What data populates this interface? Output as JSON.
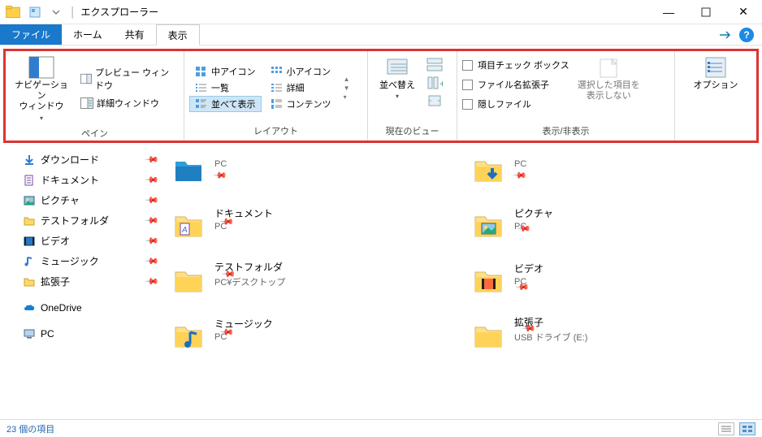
{
  "title": "エクスプローラー",
  "tabs": {
    "file": "ファイル",
    "home": "ホーム",
    "share": "共有",
    "view": "表示"
  },
  "ribbon": {
    "panes": {
      "label": "ペイン",
      "nav": "ナビゲーション\nウィンドウ",
      "preview": "プレビュー ウィンドウ",
      "details": "詳細ウィンドウ"
    },
    "layout": {
      "label": "レイアウト",
      "medium": "中アイコン",
      "small": "小アイコン",
      "list": "一覧",
      "details": "詳細",
      "tiles": "並べて表示",
      "content": "コンテンツ"
    },
    "currentview": {
      "label": "現在のビュー",
      "sort": "並べ替え"
    },
    "showhide": {
      "label": "表示/非表示",
      "checkboxes": "項目チェック ボックス",
      "extensions": "ファイル名拡張子",
      "hidden": "隠しファイル",
      "hideSelected": "選択した項目を\n表示しない"
    },
    "options": "オプション"
  },
  "nav": [
    {
      "icon": "download",
      "label": "ダウンロード",
      "pin": true
    },
    {
      "icon": "doc",
      "label": "ドキュメント",
      "pin": true
    },
    {
      "icon": "picture",
      "label": "ピクチャ",
      "pin": true
    },
    {
      "icon": "folder",
      "label": "テストフォルダ",
      "pin": true
    },
    {
      "icon": "video",
      "label": "ビデオ",
      "pin": true
    },
    {
      "icon": "music",
      "label": "ミュージック",
      "pin": true
    },
    {
      "icon": "folder",
      "label": "拡張子",
      "pin": true
    },
    {
      "icon": "onedrive",
      "label": "OneDrive",
      "pin": false,
      "spaceBefore": true
    },
    {
      "icon": "pc",
      "label": "PC",
      "pin": false,
      "spaceBefore": true
    }
  ],
  "items": [
    {
      "icon": "folder-pc",
      "title": "",
      "sub": "PC",
      "pin": true
    },
    {
      "icon": "download-folder",
      "title": "",
      "sub": "PC",
      "pin": true
    },
    {
      "icon": "doc-folder",
      "title": "ドキュメント",
      "sub": "PC",
      "pin": true
    },
    {
      "icon": "picture-folder",
      "title": "ピクチャ",
      "sub": "PC",
      "pin": true
    },
    {
      "icon": "folder",
      "title": "テストフォルダ",
      "sub": "PC¥デスクトップ",
      "pin": true
    },
    {
      "icon": "video-folder",
      "title": "ビデオ",
      "sub": "PC",
      "pin": true
    },
    {
      "icon": "music-folder",
      "title": "ミュージック",
      "sub": "PC",
      "pin": true
    },
    {
      "icon": "folder",
      "title": "拡張子",
      "sub": "USB ドライブ (E:)",
      "pin": true
    }
  ],
  "status": "23 個の項目"
}
